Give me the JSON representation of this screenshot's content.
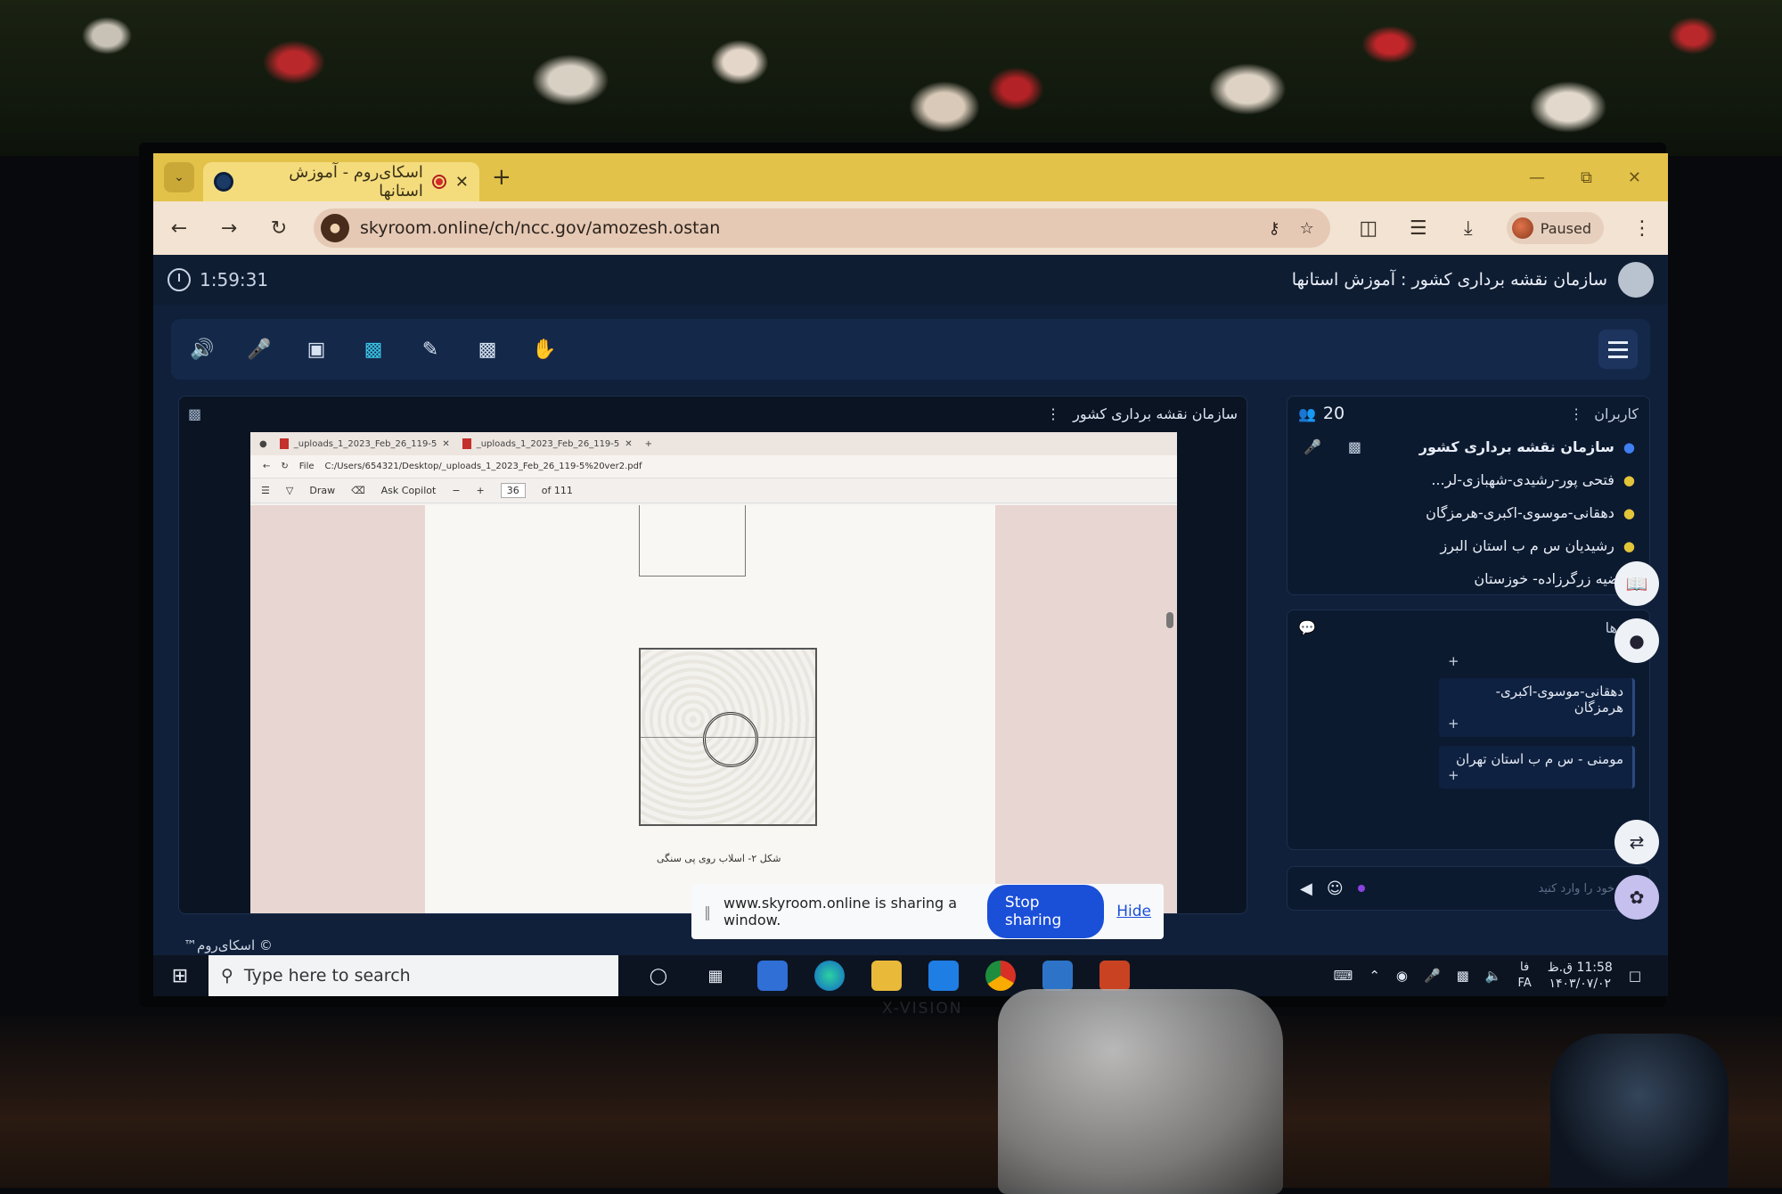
{
  "browser": {
    "tab_title": "اسکای‌روم - آموزش استانها",
    "url": "skyroom.online/ch/ncc.gov/amozesh.ostan",
    "profile_status": "Paused"
  },
  "app": {
    "timer": "1:59:31",
    "room_title": "سازمان نقشه برداری کشور : آموزش استانها",
    "presenter_title": "سازمان نقشه برداری کشور",
    "copyright": "© اسکای‌روم™"
  },
  "shared_window": {
    "tab1": "_uploads_1_2023_Feb_26_119-5",
    "tab2": "_uploads_1_2023_Feb_26_119-5",
    "file_label": "File",
    "path": "C:/Users/654321/Desktop/_uploads_1_2023_Feb_26_119-5%20ver2.pdf",
    "draw_label": "Draw",
    "ask_copilot": "Ask Copilot",
    "page_current": "36",
    "page_total": "of 111",
    "caption": "شکل ۲- اسلاب روی پی سنگی"
  },
  "share_banner": {
    "message": "www.skyroom.online is sharing a window.",
    "stop_label": "Stop sharing",
    "hide_label": "Hide"
  },
  "users": {
    "count": "20",
    "label": "کاربران",
    "items": [
      {
        "name": "سازمان نقشه برداری کشور",
        "role": "host"
      },
      {
        "name": "فتحی پور-رشیدی-شهبازی-لر...",
        "role": "guest"
      },
      {
        "name": "دهقانی-موسوی-اکبری-هرمزگان",
        "role": "guest"
      },
      {
        "name": "رشیدیان س م ب استان البرز",
        "role": "guest"
      },
      {
        "name": "مرضیه زرگرزاده- خوزستان",
        "role": "guest"
      }
    ]
  },
  "messages": {
    "label": "پیام‌ها",
    "items": [
      {
        "sender": "دهقانی-موسوی-اکبری-هرمزگان",
        "text": "+"
      },
      {
        "sender": "مومنی - س م ب استان تهران",
        "text": "+"
      }
    ],
    "first_text": "+",
    "input_placeholder": "متن خود را وارد کنید"
  },
  "taskbar": {
    "search_placeholder": "Type here to search",
    "time": "11:58 ق.ظ",
    "date": "۱۴۰۳/۰۷/۰۲",
    "lang_top": "فا",
    "lang_bottom": "FA"
  },
  "monitor_brand": "X-VISION"
}
